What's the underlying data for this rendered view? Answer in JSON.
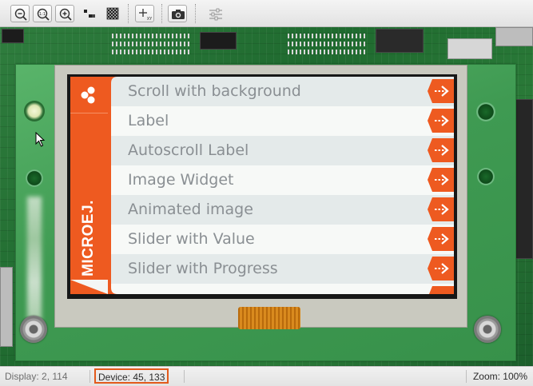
{
  "toolbar": {
    "buttons": [
      {
        "name": "zoom-out-icon"
      },
      {
        "name": "zoom-reset-icon",
        "label": "1:1"
      },
      {
        "name": "zoom-in-icon"
      },
      {
        "name": "pixel-grid-icon"
      },
      {
        "name": "checkerboard-icon"
      },
      {
        "name": "pointer-coordinates-icon",
        "label": "XY"
      },
      {
        "name": "camera-icon"
      },
      {
        "name": "settings-sliders-icon"
      }
    ]
  },
  "device_screen": {
    "brand": "MICROEJ.",
    "items": [
      {
        "label": "Scroll with background"
      },
      {
        "label": "Label"
      },
      {
        "label": "Autoscroll Label"
      },
      {
        "label": "Image Widget"
      },
      {
        "label": "Animated image"
      },
      {
        "label": "Slider with Value"
      },
      {
        "label": "Slider with Progress"
      }
    ],
    "colors": {
      "accent": "#ee5a20",
      "row_light": "#f7f9f7",
      "row_dark": "#e4eaea",
      "label": "#8a8f93"
    }
  },
  "statusbar": {
    "display": "Display: 2, 114",
    "device": "Device: 45, 133",
    "zoom": "Zoom: 100%"
  }
}
